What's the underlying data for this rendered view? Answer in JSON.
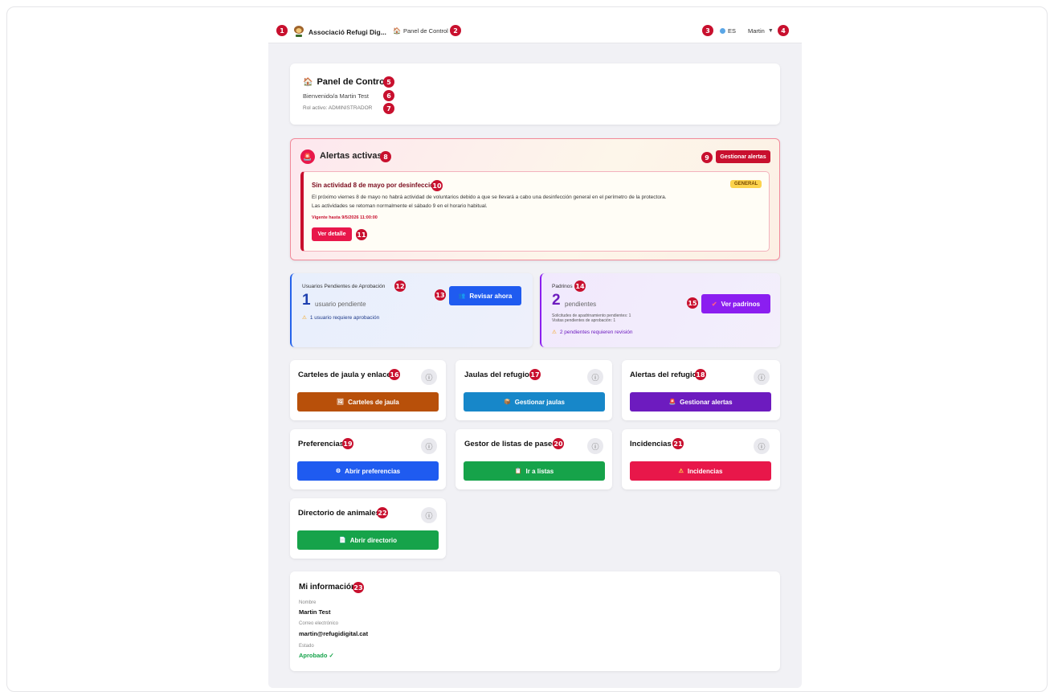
{
  "topbar": {
    "org_name": "Associació Refugi Dig...",
    "nav_label": "Panel de Control",
    "lang": "ES",
    "user": "Martin"
  },
  "header": {
    "title": "Panel de Control",
    "welcome": "Bienvenido/a Martin Test",
    "role": "Rol activo: ADMINISTRADOR"
  },
  "alerts": {
    "title": "Alertas activas",
    "manage_label": "Gestionar alertas",
    "item": {
      "title": "Sin actividad 8 de mayo por desinfección",
      "badge": "GENERAL",
      "line1": "El próximo viernes 8 de mayo no habrá actividad de voluntarios debido a que se llevará a cabo una desinfección general en el perímetro de la protectora.",
      "line2": "Las actividades se retoman normalmente el sábado 9 en el horario habitual.",
      "valid_until": "Vigente hasta 9/5/2026 11:00:00",
      "detail_label": "Ver detalle"
    }
  },
  "pending_users": {
    "title": "Usuarios Pendientes de Aprobación",
    "count": "1",
    "unit": "usuario pendiente",
    "note": "1 usuario requiere aprobación",
    "button": "Revisar ahora"
  },
  "padrinos": {
    "title": "Padrinos",
    "count": "2",
    "unit": "pendientes",
    "detail1": "Solicitudes de apadrinamiento pendientes: 1",
    "detail2": "Visitas pendientes de aprobación: 1",
    "note": "2 pendientes requieren revisión",
    "button": "Ver padrinos"
  },
  "tiles": [
    {
      "title": "Carteles de jaula y enlaces",
      "button": "Carteles de jaula",
      "color": "#b8500a"
    },
    {
      "title": "Jaulas del refugio",
      "button": "Gestionar jaulas",
      "color": "#1787c9"
    },
    {
      "title": "Alertas del refugio",
      "button": "Gestionar alertas",
      "color": "#6d1bbf"
    },
    {
      "title": "Preferencias",
      "button": "Abrir preferencias",
      "color": "#1f5bf0"
    },
    {
      "title": "Gestor de listas de paseo",
      "button": "Ir a listas",
      "color": "#16a34a"
    },
    {
      "title": "Incidencias",
      "button": "Incidencias",
      "color": "#e8174a"
    },
    {
      "title": "Directorio de animales",
      "button": "Abrir directorio",
      "color": "#16a34a"
    }
  ],
  "info_glyph": "ⓘ",
  "my_info": {
    "title": "Mi información",
    "name_label": "Nombre",
    "name": "Martin Test",
    "email_label": "Correo electrónico",
    "email": "martin@refugidigital.cat",
    "status_label": "Estado",
    "status": "Aprobado ✓"
  },
  "markers": [
    "1",
    "2",
    "3",
    "4",
    "5",
    "6",
    "7",
    "8",
    "9",
    "10",
    "11",
    "12",
    "13",
    "14",
    "15",
    "16",
    "17",
    "18",
    "19",
    "20",
    "21",
    "22",
    "23"
  ],
  "icons": {
    "logo": "logo-icon",
    "house": "house-icon",
    "globe": "globe-icon",
    "caret": "caret-down-icon",
    "siren": "siren-icon",
    "warning": "warning-icon",
    "people": "people-icon",
    "check": "check-icon",
    "picture": "picture-icon",
    "box": "box-icon",
    "gear": "gear-icon",
    "clipboard": "clipboard-icon",
    "document": "document-icon"
  },
  "colors": {
    "accent_red": "#c8102e",
    "blue_button": "#1f5bf0",
    "purple_button": "#8b1ef0",
    "approved_green": "#16a34a"
  }
}
